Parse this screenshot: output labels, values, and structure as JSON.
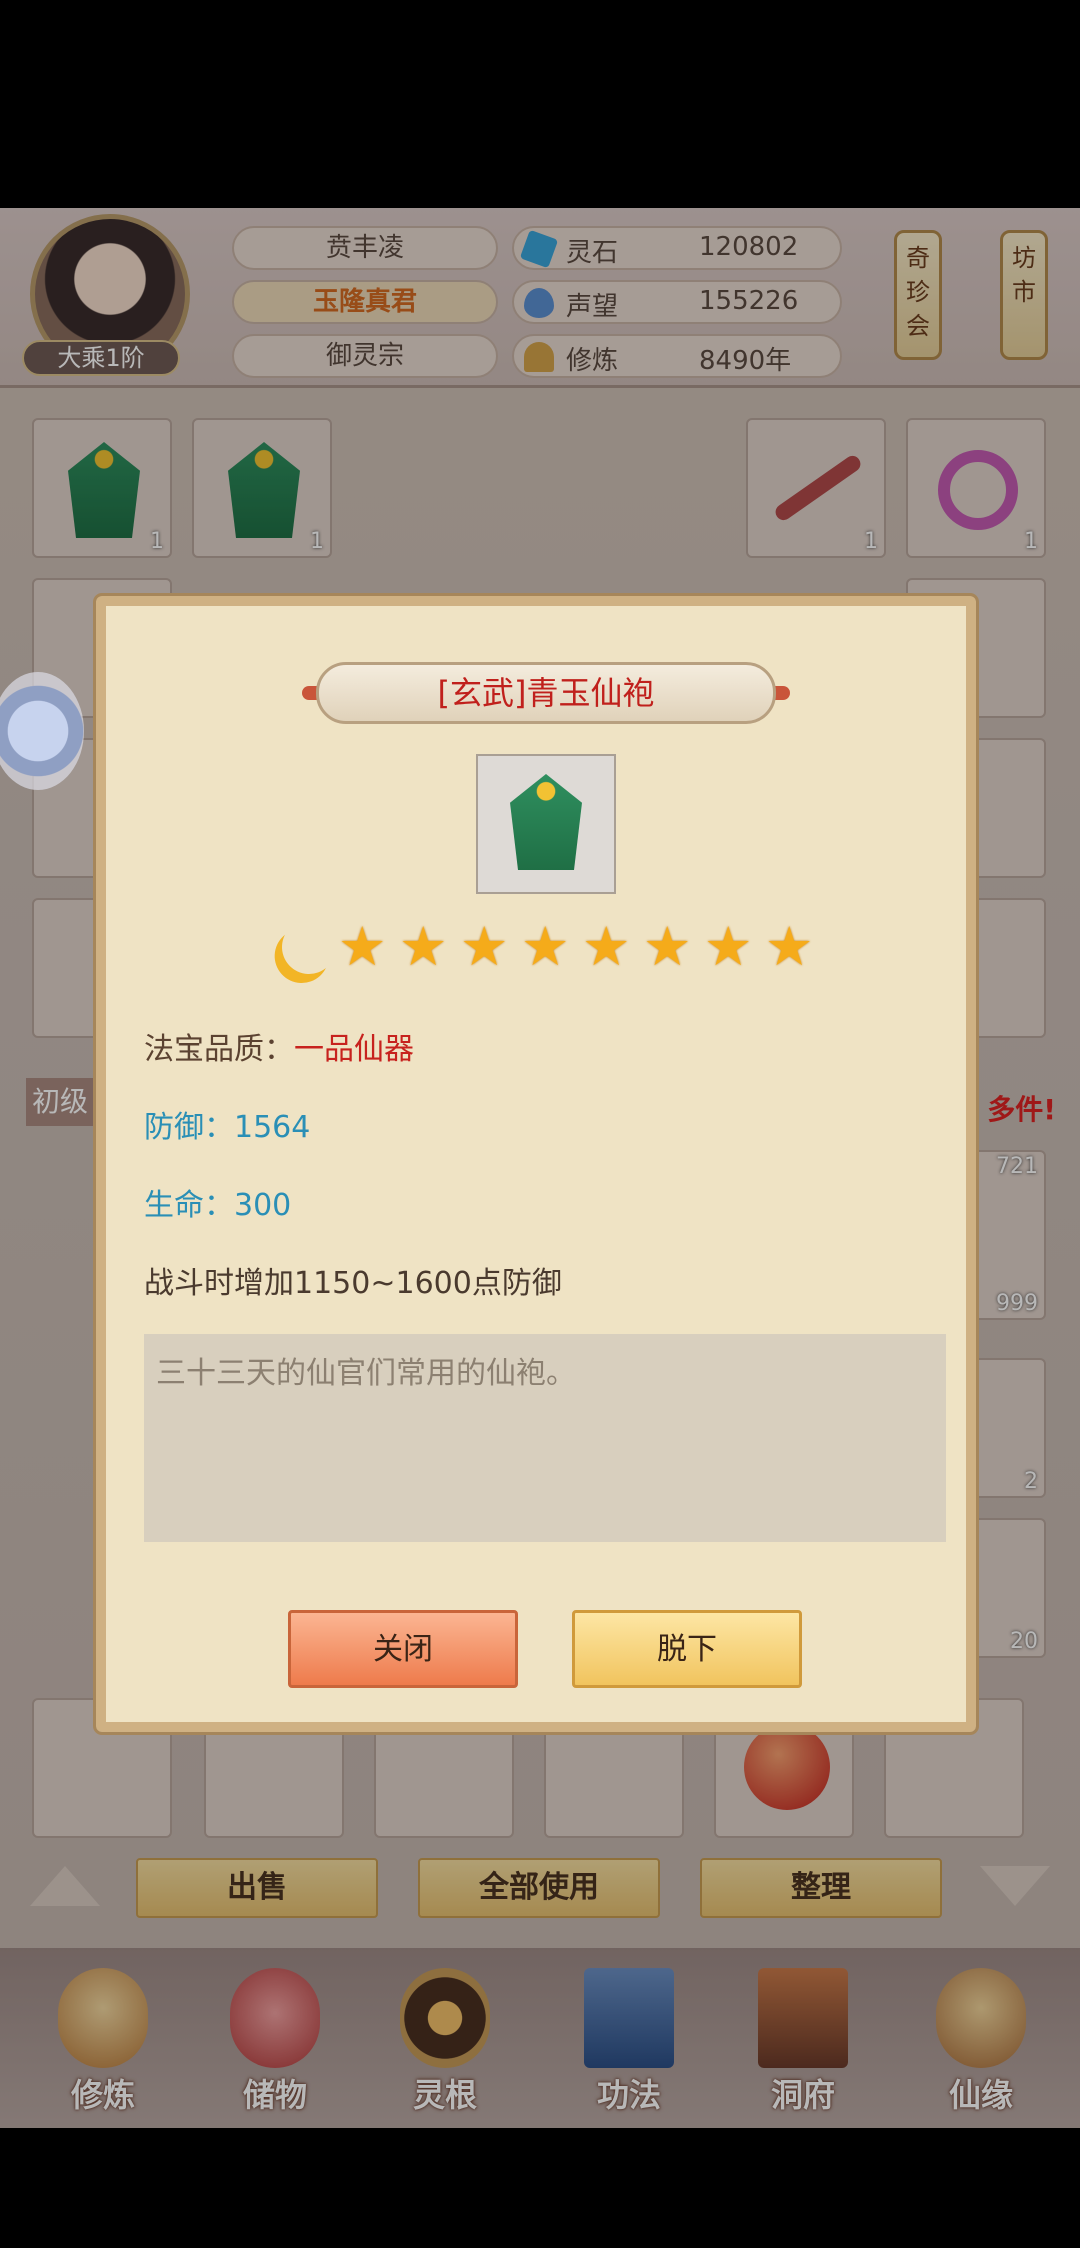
{
  "player": {
    "realm": "大乘1阶",
    "name": "贲丰凌",
    "title": "玉隆真君",
    "sect": "御灵宗"
  },
  "stats": [
    {
      "icon": "spirit-stone-icon",
      "label": "灵石",
      "value": "120802"
    },
    {
      "icon": "prestige-icon",
      "label": "声望",
      "value": "155226"
    },
    {
      "icon": "cultivation-icon",
      "label": "修炼",
      "value": "8490年"
    }
  ],
  "side_buttons": {
    "treasure": "奇珍会",
    "market": "坊市"
  },
  "inventory": {
    "top_row_counts": [
      "1",
      "1",
      "1",
      "1"
    ],
    "tab_label": "初级",
    "promo_text": "多件!",
    "visible_counts": [
      "721",
      "999",
      "2",
      "20"
    ]
  },
  "actions": {
    "sell": "出售",
    "use_all": "全部使用",
    "organize": "整理"
  },
  "nav": [
    {
      "label": "修炼",
      "icon": "cultivate-icon"
    },
    {
      "label": "储物",
      "icon": "storage-bag-icon"
    },
    {
      "label": "灵根",
      "icon": "spirit-root-icon"
    },
    {
      "label": "功法",
      "icon": "technique-book-icon"
    },
    {
      "label": "洞府",
      "icon": "cave-dwelling-icon"
    },
    {
      "label": "仙缘",
      "icon": "immortal-fate-icon"
    }
  ],
  "modal": {
    "title": "[玄武]青玉仙袍",
    "moons": 1,
    "stars": 8,
    "quality_key": "法宝品质：",
    "quality_value": "一品仙器",
    "defense": "防御：1564",
    "hp": "生命：300",
    "effect": "战斗时增加1150~1600点防御",
    "description": "三十三天的仙官们常用的仙袍。",
    "close_label": "关闭",
    "takeoff_label": "脱下"
  },
  "colors": {
    "quality_red": "#c7221e",
    "stat_blue": "#2a8fb6",
    "star_gold": "#f5ab1a"
  }
}
